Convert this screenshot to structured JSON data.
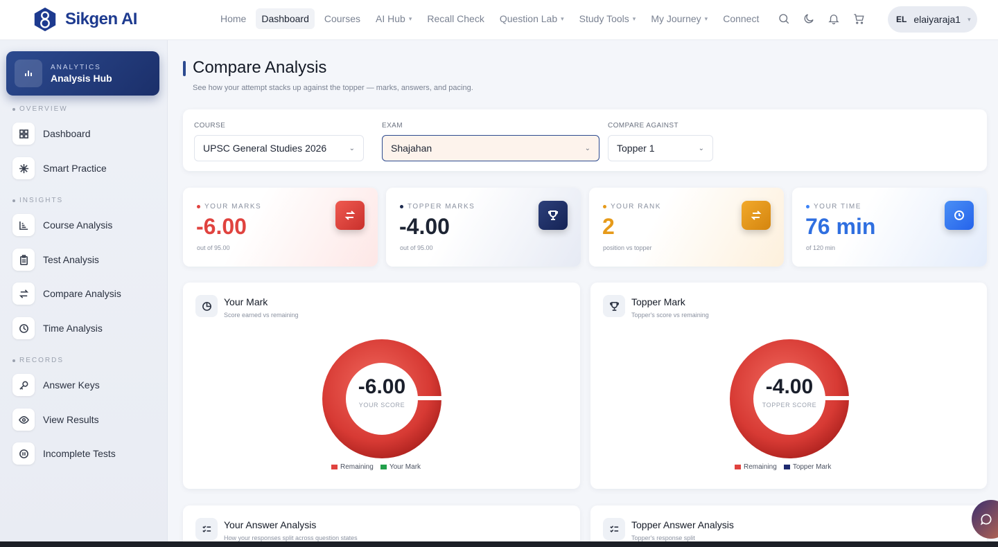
{
  "brand": {
    "name": "Sikgen AI"
  },
  "nav": [
    {
      "label": "Home",
      "active": false,
      "dropdown": false
    },
    {
      "label": "Dashboard",
      "active": true,
      "dropdown": false
    },
    {
      "label": "Courses",
      "active": false,
      "dropdown": false
    },
    {
      "label": "AI Hub",
      "active": false,
      "dropdown": true
    },
    {
      "label": "Recall Check",
      "active": false,
      "dropdown": false
    },
    {
      "label": "Question Lab",
      "active": false,
      "dropdown": true
    },
    {
      "label": "Study Tools",
      "active": false,
      "dropdown": true
    },
    {
      "label": "My Journey",
      "active": false,
      "dropdown": true
    },
    {
      "label": "Connect",
      "active": false,
      "dropdown": false
    }
  ],
  "top_icons": [
    "search-icon",
    "moon-icon",
    "bell-icon",
    "cart-icon"
  ],
  "user": {
    "initials": "EL",
    "name": "elaiyaraja1"
  },
  "sidebar": {
    "hub": {
      "kicker": "ANALYTICS",
      "title": "Analysis Hub"
    },
    "sections": [
      {
        "label": "OVERVIEW",
        "items": [
          {
            "label": "Dashboard",
            "icon": "grid-icon"
          },
          {
            "label": "Smart Practice",
            "icon": "sparkle-icon"
          }
        ]
      },
      {
        "label": "INSIGHTS",
        "items": [
          {
            "label": "Course Analysis",
            "icon": "bar-chart-icon"
          },
          {
            "label": "Test Analysis",
            "icon": "clipboard-icon"
          },
          {
            "label": "Compare Analysis",
            "icon": "swap-icon"
          },
          {
            "label": "Time Analysis",
            "icon": "clock-icon"
          }
        ]
      },
      {
        "label": "RECORDS",
        "items": [
          {
            "label": "Answer Keys",
            "icon": "key-icon"
          },
          {
            "label": "View Results",
            "icon": "eye-icon"
          },
          {
            "label": "Incomplete Tests",
            "icon": "pause-icon"
          }
        ]
      }
    ]
  },
  "page": {
    "title": "Compare Analysis",
    "subtitle": "See how your attempt stacks up against the topper — marks, answers, and pacing."
  },
  "filters": {
    "course": {
      "label": "COURSE",
      "value": "UPSC General Studies 2026"
    },
    "exam": {
      "label": "EXAM",
      "value": "Shajahan"
    },
    "compare": {
      "label": "COMPARE AGAINST",
      "value": "Topper 1"
    }
  },
  "stats": [
    {
      "label": "YOUR MARKS",
      "value": "-6.00",
      "note": "out of 95.00",
      "color": "#e0433f",
      "icon": "swap-icon"
    },
    {
      "label": "TOPPER MARKS",
      "value": "-4.00",
      "note": "out of 95.00",
      "color": "#1d2a4f",
      "icon": "trophy-icon"
    },
    {
      "label": "YOUR RANK",
      "value": "2",
      "note": "position vs topper",
      "color": "#e69a1a",
      "icon": "swap-icon"
    },
    {
      "label": "YOUR TIME",
      "value": "76 min",
      "note": "of 120 min",
      "color": "#3b82f6",
      "icon": "clock-icon"
    }
  ],
  "charts": {
    "your": {
      "title": "Your Mark",
      "subtitle": "Score earned vs remaining",
      "value": "-6.00",
      "caption": "YOUR SCORE",
      "legend": [
        "Remaining",
        "Your Mark"
      ]
    },
    "topper": {
      "title": "Topper Mark",
      "subtitle": "Topper's score vs remaining",
      "value": "-4.00",
      "caption": "TOPPER SCORE",
      "legend": [
        "Remaining",
        "Topper Mark"
      ]
    }
  },
  "answer_cards": {
    "your": {
      "title": "Your Answer Analysis",
      "subtitle": "How your responses split across question states"
    },
    "topper": {
      "title": "Topper Answer Analysis",
      "subtitle": "Topper's response split"
    }
  },
  "colors": {
    "accent": "#2c4a8f",
    "remaining": "#e0433f",
    "your_mark": "#22a04b",
    "topper_mark": "#1d2a6f"
  }
}
